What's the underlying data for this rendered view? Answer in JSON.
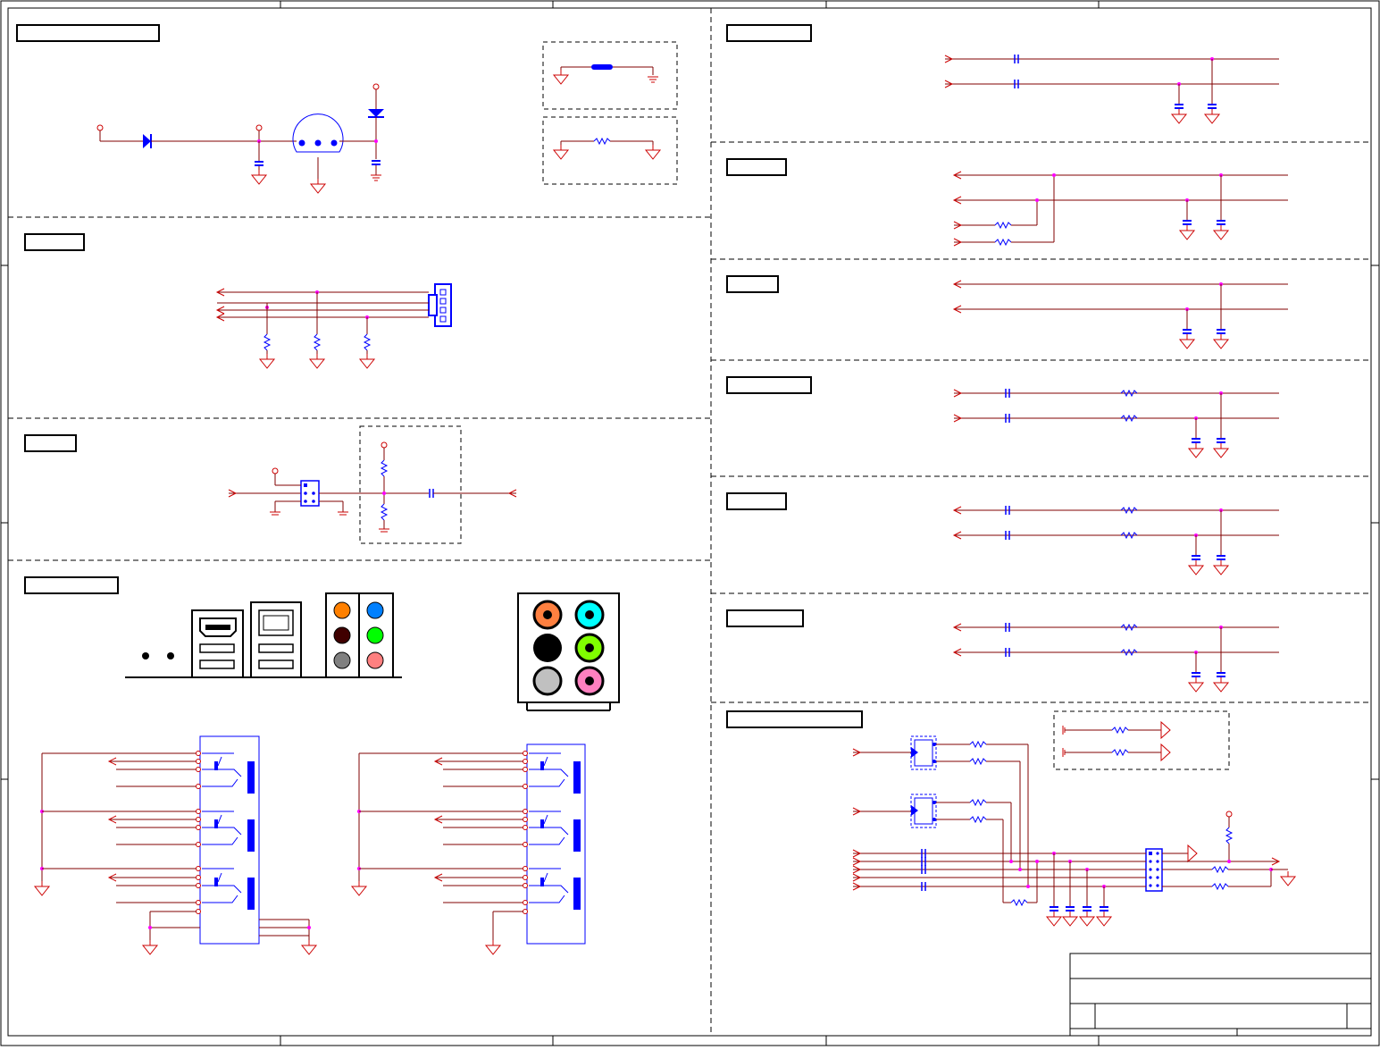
{
  "sheet": {
    "border_color": "#000000",
    "wire_color": "#800000",
    "component_color": "#0000ff",
    "ground_color": "#cc0000",
    "junction_color": "#ff00ff",
    "section_divider_style": "dashed"
  },
  "sections": [
    {
      "id": "power-led",
      "title": ""
    },
    {
      "id": "fan-header",
      "title": ""
    },
    {
      "id": "buzzer",
      "title": ""
    },
    {
      "id": "audio-io",
      "title": ""
    },
    {
      "id": "rgb-r",
      "title": ""
    },
    {
      "id": "hsync",
      "title": ""
    },
    {
      "id": "vsync",
      "title": ""
    },
    {
      "id": "rgb-g",
      "title": ""
    },
    {
      "id": "rgb-b",
      "title": ""
    },
    {
      "id": "ddc",
      "title": ""
    },
    {
      "id": "usb-esd",
      "title": ""
    }
  ],
  "rear_panel": {
    "audio_jack_colors_3": [
      "#ff8000",
      "#0080ff",
      "#400000",
      "#00ff00",
      "#808080",
      "#ff8080"
    ],
    "audio_jack_colors_6": [
      "#ff8040",
      "#00ffff",
      "#000000",
      "#80ff00",
      "#c0c0c0",
      "#ff80c0"
    ]
  },
  "title_block": {
    "title": "",
    "document_number": "",
    "revision": "",
    "size": "",
    "date": "",
    "sheet": ""
  }
}
